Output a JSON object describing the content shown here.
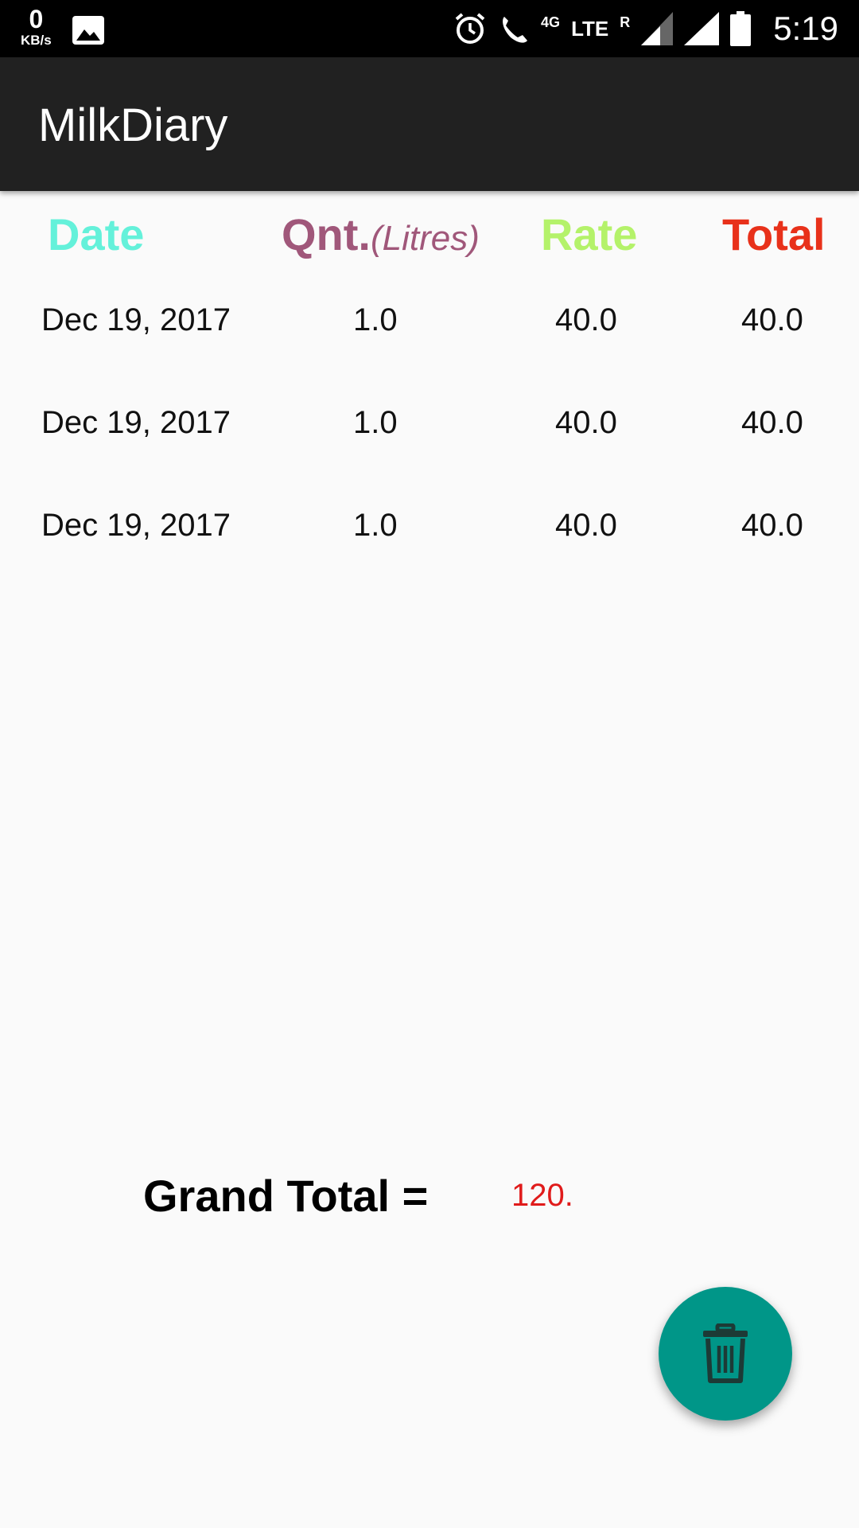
{
  "status_bar": {
    "net_speed_value": "0",
    "net_speed_unit": "KB/s",
    "network_4g": "4G",
    "network_lte": "LTE",
    "roaming": "R",
    "time": "5:19",
    "icons": [
      "image-icon",
      "alarm-icon",
      "wifi-call-icon",
      "signal-icon",
      "signal-icon",
      "battery-icon"
    ]
  },
  "app_bar": {
    "title": "MilkDiary"
  },
  "table": {
    "headers": {
      "date": "Date",
      "qnt": "Qnt.",
      "qnt_unit": "(Litres)",
      "rate": "Rate",
      "total": "Total"
    },
    "rows": [
      {
        "date": "Dec 19, 2017",
        "qnt": "1.0",
        "rate": "40.0",
        "total": "40.0"
      },
      {
        "date": "Dec 19, 2017",
        "qnt": "1.0",
        "rate": "40.0",
        "total": "40.0"
      },
      {
        "date": "Dec 19, 2017",
        "qnt": "1.0",
        "rate": "40.0",
        "total": "40.0"
      }
    ]
  },
  "grand_total": {
    "label": "Grand Total =",
    "value": "120."
  },
  "fab": {
    "icon": "trash-icon"
  },
  "colors": {
    "app_bar": "#212121",
    "date_header": "#64f1da",
    "qnt_header": "#a0577a",
    "rate_header": "#b4f26a",
    "total_header": "#e8311a",
    "grand_total_value": "#e01b1b",
    "fab": "#009688"
  }
}
